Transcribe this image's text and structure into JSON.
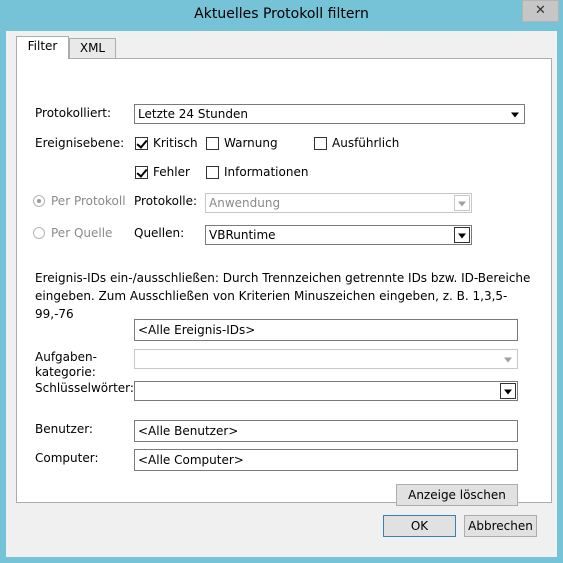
{
  "window": {
    "title": "Aktuelles Protokoll filtern",
    "close_label": "✕"
  },
  "tabs": [
    {
      "label": "Filter"
    },
    {
      "label": "XML"
    }
  ],
  "filter": {
    "logged_label": "Protokolliert:",
    "logged_value": "Letzte 24 Stunden",
    "level_label": "Ereignisebene:",
    "levels": {
      "critical": {
        "label": "Kritisch",
        "checked": true
      },
      "warning": {
        "label": "Warnung",
        "checked": false
      },
      "verbose": {
        "label": "Ausführlich",
        "checked": false
      },
      "error": {
        "label": "Fehler",
        "checked": true
      },
      "information": {
        "label": "Informationen",
        "checked": false
      }
    },
    "by_log_label": "Per Protokoll",
    "by_source_label": "Per Quelle",
    "logs_label": "Protokolle:",
    "logs_value": "Anwendung",
    "sources_label": "Quellen:",
    "sources_value": "VBRuntime",
    "event_ids_description": "Ereignis-IDs ein-/ausschließen: Durch Trennzeichen getrennte IDs bzw. ID-Bereiche eingeben. Zum Ausschließen von Kriterien Minuszeichen eingeben, z. B. 1,3,5-99,-76",
    "event_ids_value": "<Alle Ereignis-IDs>",
    "task_category_label_1": "Aufgaben-",
    "task_category_label_2": "kategorie:",
    "keywords_label": "Schlüsselwörter:",
    "user_label": "Benutzer:",
    "user_value": "<Alle Benutzer>",
    "computer_label": "Computer:",
    "computer_value": "<Alle Computer>",
    "clear_label": "Anzeige löschen"
  },
  "footer": {
    "ok_label": "OK",
    "cancel_label": "Abbrechen"
  }
}
